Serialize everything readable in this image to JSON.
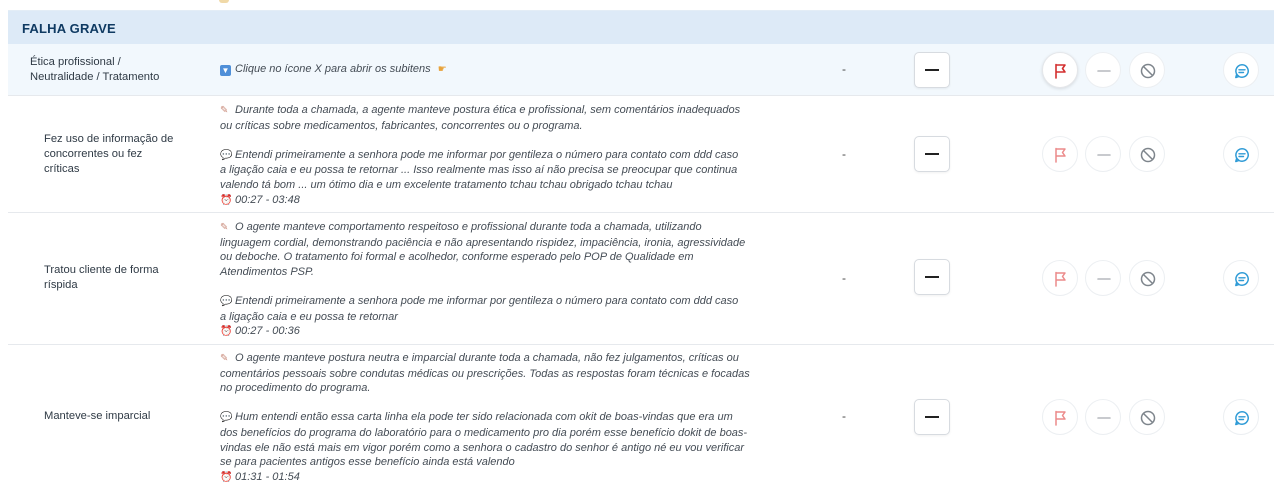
{
  "section": {
    "title": "FALHA GRAVE"
  },
  "rows": [
    {
      "label_lines": [
        "Ética profissional /",
        "Neutralidade / Tratamento"
      ],
      "hint": "Clique no ícone X para abrir os subitens",
      "value": "-"
    },
    {
      "label_lines": [
        "Fez uso de informação de",
        "concorrentes ou fez",
        "críticas"
      ],
      "analysis_lines": [
        "Durante toda a chamada, a agente manteve postura ética e profissional, sem comentários inadequados",
        "ou críticas sobre medicamentos, fabricantes, concorrentes ou o programa."
      ],
      "quote_lines": [
        "Entendi primeiramente a senhora pode me informar por gentileza o número para contato com ddd caso",
        "a ligação caia e eu possa te retornar ... Isso realmente mas isso aí não precisa se preocupar que continua",
        "valendo tá bom ... um ótimo dia e um excelente tratamento tchau tchau obrigado tchau tchau"
      ],
      "time": "00:27 - 03:48",
      "value": "-"
    },
    {
      "label_lines": [
        "Tratou cliente de forma",
        "ríspida"
      ],
      "analysis_lines": [
        "O agente manteve comportamento respeitoso e profissional durante toda a chamada, utilizando",
        "linguagem cordial, demonstrando paciência e não apresentando rispidez, impaciência, ironia, agressividade",
        "ou deboche. O tratamento foi formal e acolhedor, conforme esperado pelo POP de Qualidade em",
        "Atendimentos PSP."
      ],
      "quote_lines": [
        "Entendi primeiramente a senhora pode me informar por gentileza o número para contato com ddd caso",
        "a ligação caia e eu possa te retornar"
      ],
      "time": "00:27 - 00:36",
      "value": "-"
    },
    {
      "label_lines": [
        "Manteve-se imparcial"
      ],
      "analysis_lines": [
        "O agente manteve postura neutra e imparcial durante toda a chamada, não fez julgamentos, críticas ou",
        "comentários pessoais sobre condutas médicas ou prescrições. Todas as respostas foram técnicas e focadas",
        "no procedimento do programa."
      ],
      "quote_lines": [
        "Hum entendi então essa carta linha ela pode ter sido relacionada com okit de boas-vindas que era um",
        "dos benefícios do programa do laboratório para o medicamento pro dia porém esse benefício dokit de boas-",
        "vindas ele não está mais em vigor porém como a senhora o cadastro do senhor é antigo né eu vou verificar",
        "se para pacientes antigos esse benefício ainda está valendo"
      ],
      "time": "01:31 - 01:54",
      "value": "-"
    }
  ],
  "icons": {
    "minus": "minus-icon",
    "flag": "flag-icon",
    "dash": "dash-icon",
    "block": "block-icon",
    "comment": "comment-icon"
  },
  "colors": {
    "header_bg": "#ddeaf7",
    "header_text": "#0f3a62",
    "flag_active": "#d32f2f",
    "flag_inactive": "#ec8a8a",
    "comment": "#2f9bd6"
  }
}
